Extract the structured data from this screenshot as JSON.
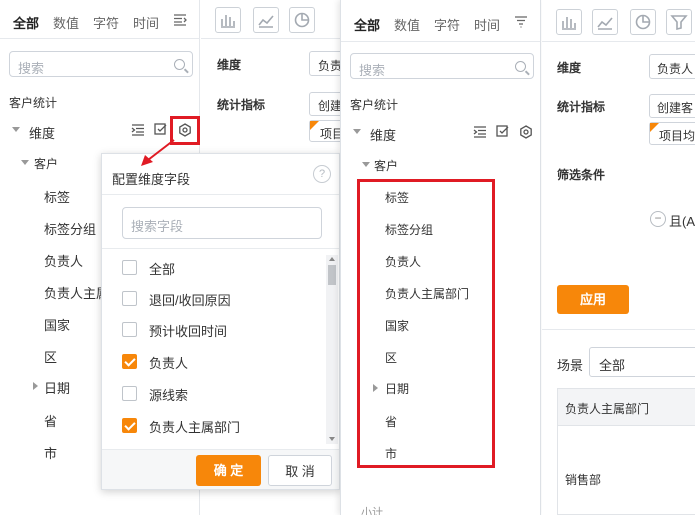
{
  "left_panel": {
    "tabs": [
      "全部",
      "数值",
      "字符",
      "时间"
    ],
    "search_placeholder": "搜索",
    "section": "客户统计",
    "dimension_label": "维度",
    "group": "客户",
    "fields": [
      "标签",
      "标签分组",
      "负责人",
      "负责人主属",
      "国家",
      "区",
      "日期",
      "省",
      "市"
    ]
  },
  "middle_panel": {
    "dimension_label": "维度",
    "dimension_value": "负责",
    "metric_label": "统计指标",
    "metric_value": "创建",
    "tag_text": "项目"
  },
  "popup": {
    "title": "配置维度字段",
    "help": "?",
    "search_placeholder": "搜索字段",
    "options": [
      {
        "label": "全部",
        "checked": false
      },
      {
        "label": "退回/收回原因",
        "checked": false
      },
      {
        "label": "预计收回时间",
        "checked": false
      },
      {
        "label": "负责人",
        "checked": true
      },
      {
        "label": "源线索",
        "checked": false
      },
      {
        "label": "负责人主属部门",
        "checked": true
      }
    ],
    "confirm": "确 定",
    "cancel": "取 消"
  },
  "front_panel": {
    "tabs": [
      "全部",
      "数值",
      "字符",
      "时间"
    ],
    "search_placeholder": "搜索",
    "section": "客户统计",
    "dimension_label": "维度",
    "group": "客户",
    "fields": [
      "标签",
      "标签分组",
      "负责人",
      "负责人主属部门",
      "国家",
      "区",
      "日期",
      "省",
      "市"
    ],
    "bottom_text": "小计"
  },
  "right_panel": {
    "dimension_label": "维度",
    "dimension_value": "负责人",
    "metric_label": "统计指标",
    "metric_value": "创建客",
    "tag_text": "项目均",
    "filter_label": "筛选条件",
    "filter_value": "且(A",
    "apply": "应用",
    "scene_label": "场景",
    "scene_value": "全部",
    "table_header": "负责人主属部门",
    "table_cell": "销售部"
  },
  "colors": {
    "accent": "#f7870a",
    "highlight": "#e01b24",
    "border": "#d7dbe0"
  }
}
